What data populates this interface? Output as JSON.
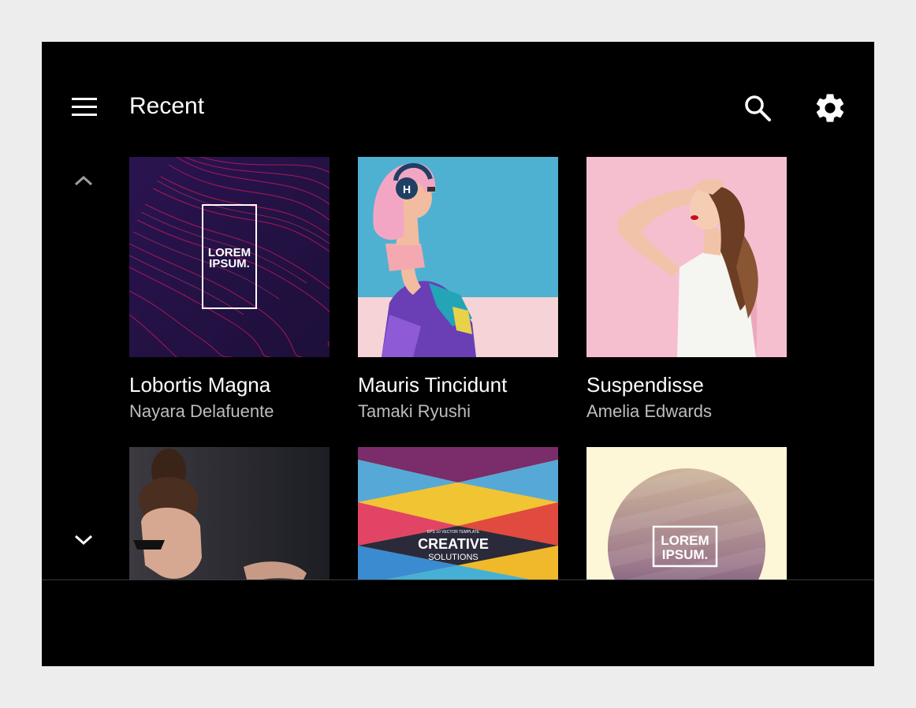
{
  "app": {
    "title": "Recent",
    "icons": {
      "menu": "menu-icon",
      "search": "search-icon",
      "settings": "gear-icon",
      "up": "chevron-up-icon",
      "down": "chevron-down-icon"
    }
  },
  "cards": [
    {
      "title": "Lobortis Magna",
      "subtitle": "Nayara Delafuente",
      "art": {
        "logo_line1": "LOREM",
        "logo_line2": "IPSUM."
      }
    },
    {
      "title": "Mauris Tincidunt",
      "subtitle": "Tamaki Ryushi",
      "art": {
        "headphone_letter": "H"
      }
    },
    {
      "title": "Suspendisse",
      "subtitle": "Amelia Edwards",
      "art": {}
    },
    {
      "title": "",
      "subtitle": "",
      "art": {}
    },
    {
      "title": "",
      "subtitle": "",
      "art": {
        "small": "EPS 10 VECTOR TEMPLATE",
        "big": "CREATIVE",
        "sub": "SOLUTIONS"
      }
    },
    {
      "title": "",
      "subtitle": "",
      "art": {
        "logo_line1": "LOREM",
        "logo_line2": "IPSUM."
      }
    }
  ],
  "colors": {
    "background": "#000000",
    "text_primary": "#ffffff",
    "text_secondary": "#bdbdbd",
    "page_background": "#ededed"
  }
}
